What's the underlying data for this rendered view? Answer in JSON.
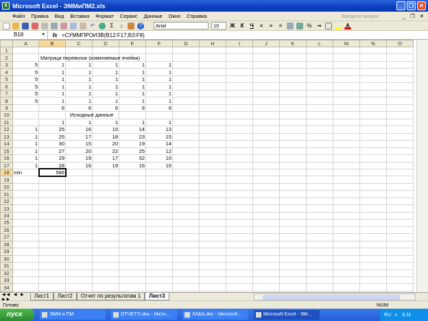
{
  "window": {
    "title": "Microsoft Excel - ЭММиПМ2.xls"
  },
  "menu": {
    "items": [
      "Файл",
      "Правка",
      "Вид",
      "Вставка",
      "Формат",
      "Сервис",
      "Данные",
      "Окно",
      "Справка"
    ],
    "ask": "Введите вопрос"
  },
  "toolbar": {
    "font": "Arial",
    "size": "10",
    "bold": "Ж",
    "italic": "К",
    "underline": "Ч",
    "percent": "%",
    "sigma": "Σ"
  },
  "formula_bar": {
    "name_box": "B18",
    "fx": "fx",
    "formula": "=СУММПРОИЗВ(B12:F17;B3:F8)"
  },
  "columns": [
    "A",
    "B",
    "C",
    "D",
    "E",
    "F",
    "G",
    "H",
    "I",
    "J",
    "K",
    "L",
    "M",
    "N",
    "O"
  ],
  "selected_col": "B",
  "selected_row": 18,
  "rows": [
    [],
    [
      "",
      "Матрица перевозок (изменяемые ячейки)"
    ],
    [
      "5",
      "1",
      "1",
      "1",
      "1",
      "1"
    ],
    [
      "5",
      "1",
      "1",
      "1",
      "1",
      "1"
    ],
    [
      "5",
      "1",
      "1",
      "1",
      "1",
      "1"
    ],
    [
      "5",
      "1",
      "1",
      "1",
      "1",
      "1"
    ],
    [
      "5",
      "1",
      "1",
      "1",
      "1",
      "1"
    ],
    [
      "5",
      "1",
      "1",
      "1",
      "1",
      "1"
    ],
    [
      "",
      "6",
      "6",
      "6",
      "6",
      "6"
    ],
    [
      "",
      "",
      "Исходные данные"
    ],
    [
      "",
      "1",
      "1",
      "1",
      "1",
      "1"
    ],
    [
      "1",
      "25",
      "16",
      "15",
      "14",
      "13"
    ],
    [
      "1",
      "25",
      "17",
      "18",
      "23",
      "15"
    ],
    [
      "1",
      "30",
      "15",
      "20",
      "19",
      "14"
    ],
    [
      "1",
      "27",
      "20",
      "22",
      "25",
      "12"
    ],
    [
      "1",
      "29",
      "19",
      "17",
      "32",
      "10"
    ],
    [
      "1",
      "28",
      "16",
      "19",
      "16",
      "15"
    ],
    [
      "min",
      "586"
    ]
  ],
  "row_count": 35,
  "sheet_tabs": [
    "Лист1",
    "Лист2",
    "Отчет по результатам 1",
    "Лист3"
  ],
  "active_tab": "Лист3",
  "status": {
    "left": "Готово",
    "num": "NUM"
  },
  "taskbar": {
    "start": "пуск",
    "tasks": [
      "ЭММ и ПМ",
      "ОТЧЕТ!!!.doc - Micro...",
      "ЛАБА.doc - Microsoft...",
      "Microsoft Excel - ЭМ..."
    ],
    "lang": "RU",
    "clock": "0:11"
  }
}
